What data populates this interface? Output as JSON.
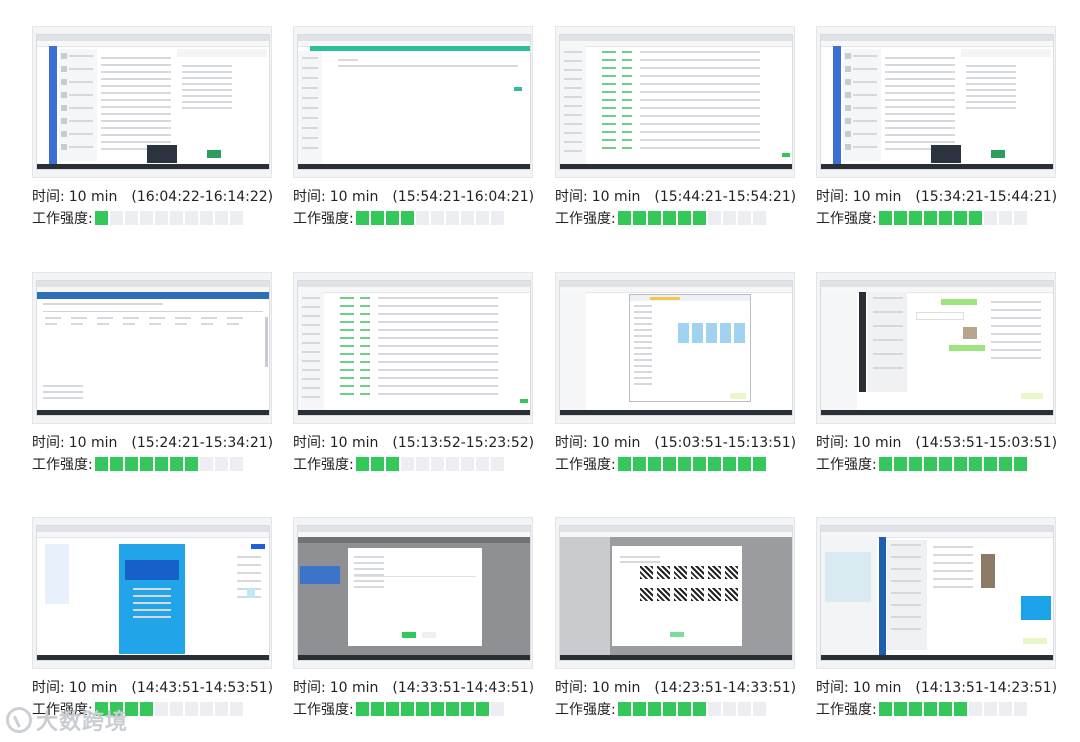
{
  "labels": {
    "time_label": "时间:",
    "intensity_label": "工作强度:"
  },
  "intensity_max": 10,
  "colors": {
    "on": "#34c759",
    "off": "#eceef1"
  },
  "watermark": "大数跨境",
  "cards": [
    {
      "duration": "10 min",
      "range": "(16:04:22-16:14:22)",
      "intensity": 1,
      "style": "chat-blue"
    },
    {
      "duration": "10 min",
      "range": "(15:54:21-16:04:21)",
      "intensity": 4,
      "style": "teal-blank"
    },
    {
      "duration": "10 min",
      "range": "(15:44:21-15:54:21)",
      "intensity": 6,
      "style": "table-green"
    },
    {
      "duration": "10 min",
      "range": "(15:34:21-15:44:21)",
      "intensity": 7,
      "style": "chat-blue"
    },
    {
      "duration": "10 min",
      "range": "(15:24:21-15:34:21)",
      "intensity": 7,
      "style": "blue-form"
    },
    {
      "duration": "10 min",
      "range": "(15:13:52-15:23:52)",
      "intensity": 3,
      "style": "table-green"
    },
    {
      "duration": "10 min",
      "range": "(15:03:51-15:13:51)",
      "intensity": 10,
      "style": "dialog-cards"
    },
    {
      "duration": "10 min",
      "range": "(14:53:51-15:03:51)",
      "intensity": 10,
      "style": "chat-dark"
    },
    {
      "duration": "10 min",
      "range": "(14:43:51-14:53:51)",
      "intensity": 4,
      "style": "poster"
    },
    {
      "duration": "10 min",
      "range": "(14:33:51-14:43:51)",
      "intensity": 9,
      "style": "grey-modal"
    },
    {
      "duration": "10 min",
      "range": "(14:23:51-14:33:51)",
      "intensity": 6,
      "style": "qr-modal"
    },
    {
      "duration": "10 min",
      "range": "(14:13:51-14:23:51)",
      "intensity": 6,
      "style": "chat-image"
    }
  ]
}
